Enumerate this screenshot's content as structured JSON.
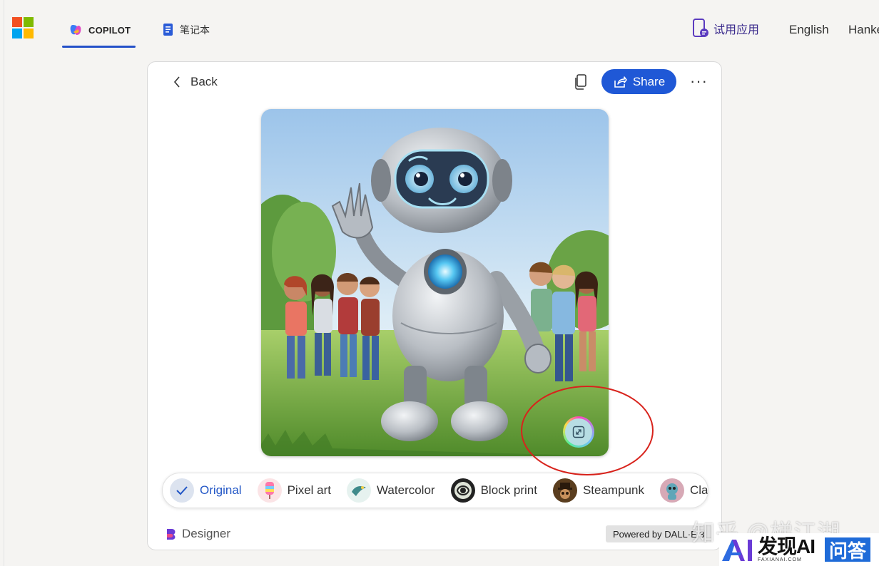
{
  "header": {
    "tabs": [
      {
        "label": "COPILOT",
        "icon": "copilot-icon",
        "active": true
      },
      {
        "label": "笔记本",
        "icon": "notebook-icon",
        "active": false
      }
    ],
    "try_app_label": "试用应用",
    "language_label": "English",
    "user_label": "Hanke"
  },
  "toolbar": {
    "back_label": "Back",
    "share_label": "Share",
    "copy_icon": "copy-icon",
    "more_icon": "more-icon"
  },
  "image": {
    "expand_icon": "expand-icon"
  },
  "styles": [
    {
      "label": "Original",
      "selected": true
    },
    {
      "label": "Pixel art",
      "selected": false
    },
    {
      "label": "Watercolor",
      "selected": false
    },
    {
      "label": "Block print",
      "selected": false
    },
    {
      "label": "Steampunk",
      "selected": false
    },
    {
      "label": "Cla",
      "selected": false
    }
  ],
  "footer": {
    "designer_label": "Designer",
    "powered_label": "Powered by DALL·E 3"
  },
  "watermark": {
    "zhihu_text": "知乎 @梯江湖",
    "ai_title": "发现AI",
    "ai_sub": "FAXIANAI.COM",
    "ai_wenda": "问答"
  },
  "colors": {
    "accent": "#1f58d6",
    "tab_underline": "#2450c8",
    "annotation": "#d8231c"
  }
}
